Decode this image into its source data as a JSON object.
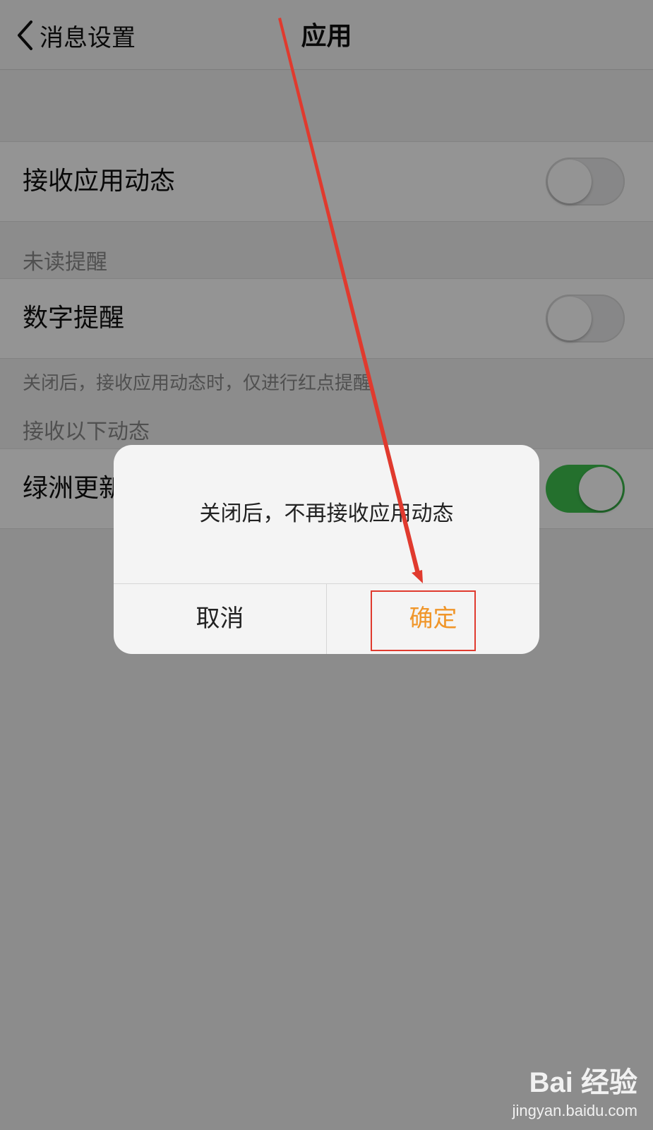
{
  "nav": {
    "back_label": "消息设置",
    "title": "应用"
  },
  "rows": {
    "receive_app_updates": {
      "label": "接收应用动态",
      "on": false
    },
    "number_reminder": {
      "label": "数字提醒",
      "on": false
    },
    "oasis_updates": {
      "label": "绿洲更新",
      "on": true
    }
  },
  "sections": {
    "unread": "未读提醒",
    "number_hint": "关闭后，接收应用动态时，仅进行红点提醒",
    "receive_following": "接收以下动态"
  },
  "dialog": {
    "message": "关闭后，不再接收应用动态",
    "cancel": "取消",
    "confirm": "确定"
  },
  "colors": {
    "accent_green": "#3ec14f",
    "confirm_orange": "#f0962a",
    "annotation_red": "#e03a2e"
  },
  "watermark": {
    "brand": "Bai 经验",
    "url": "jingyan.baidu.com"
  }
}
